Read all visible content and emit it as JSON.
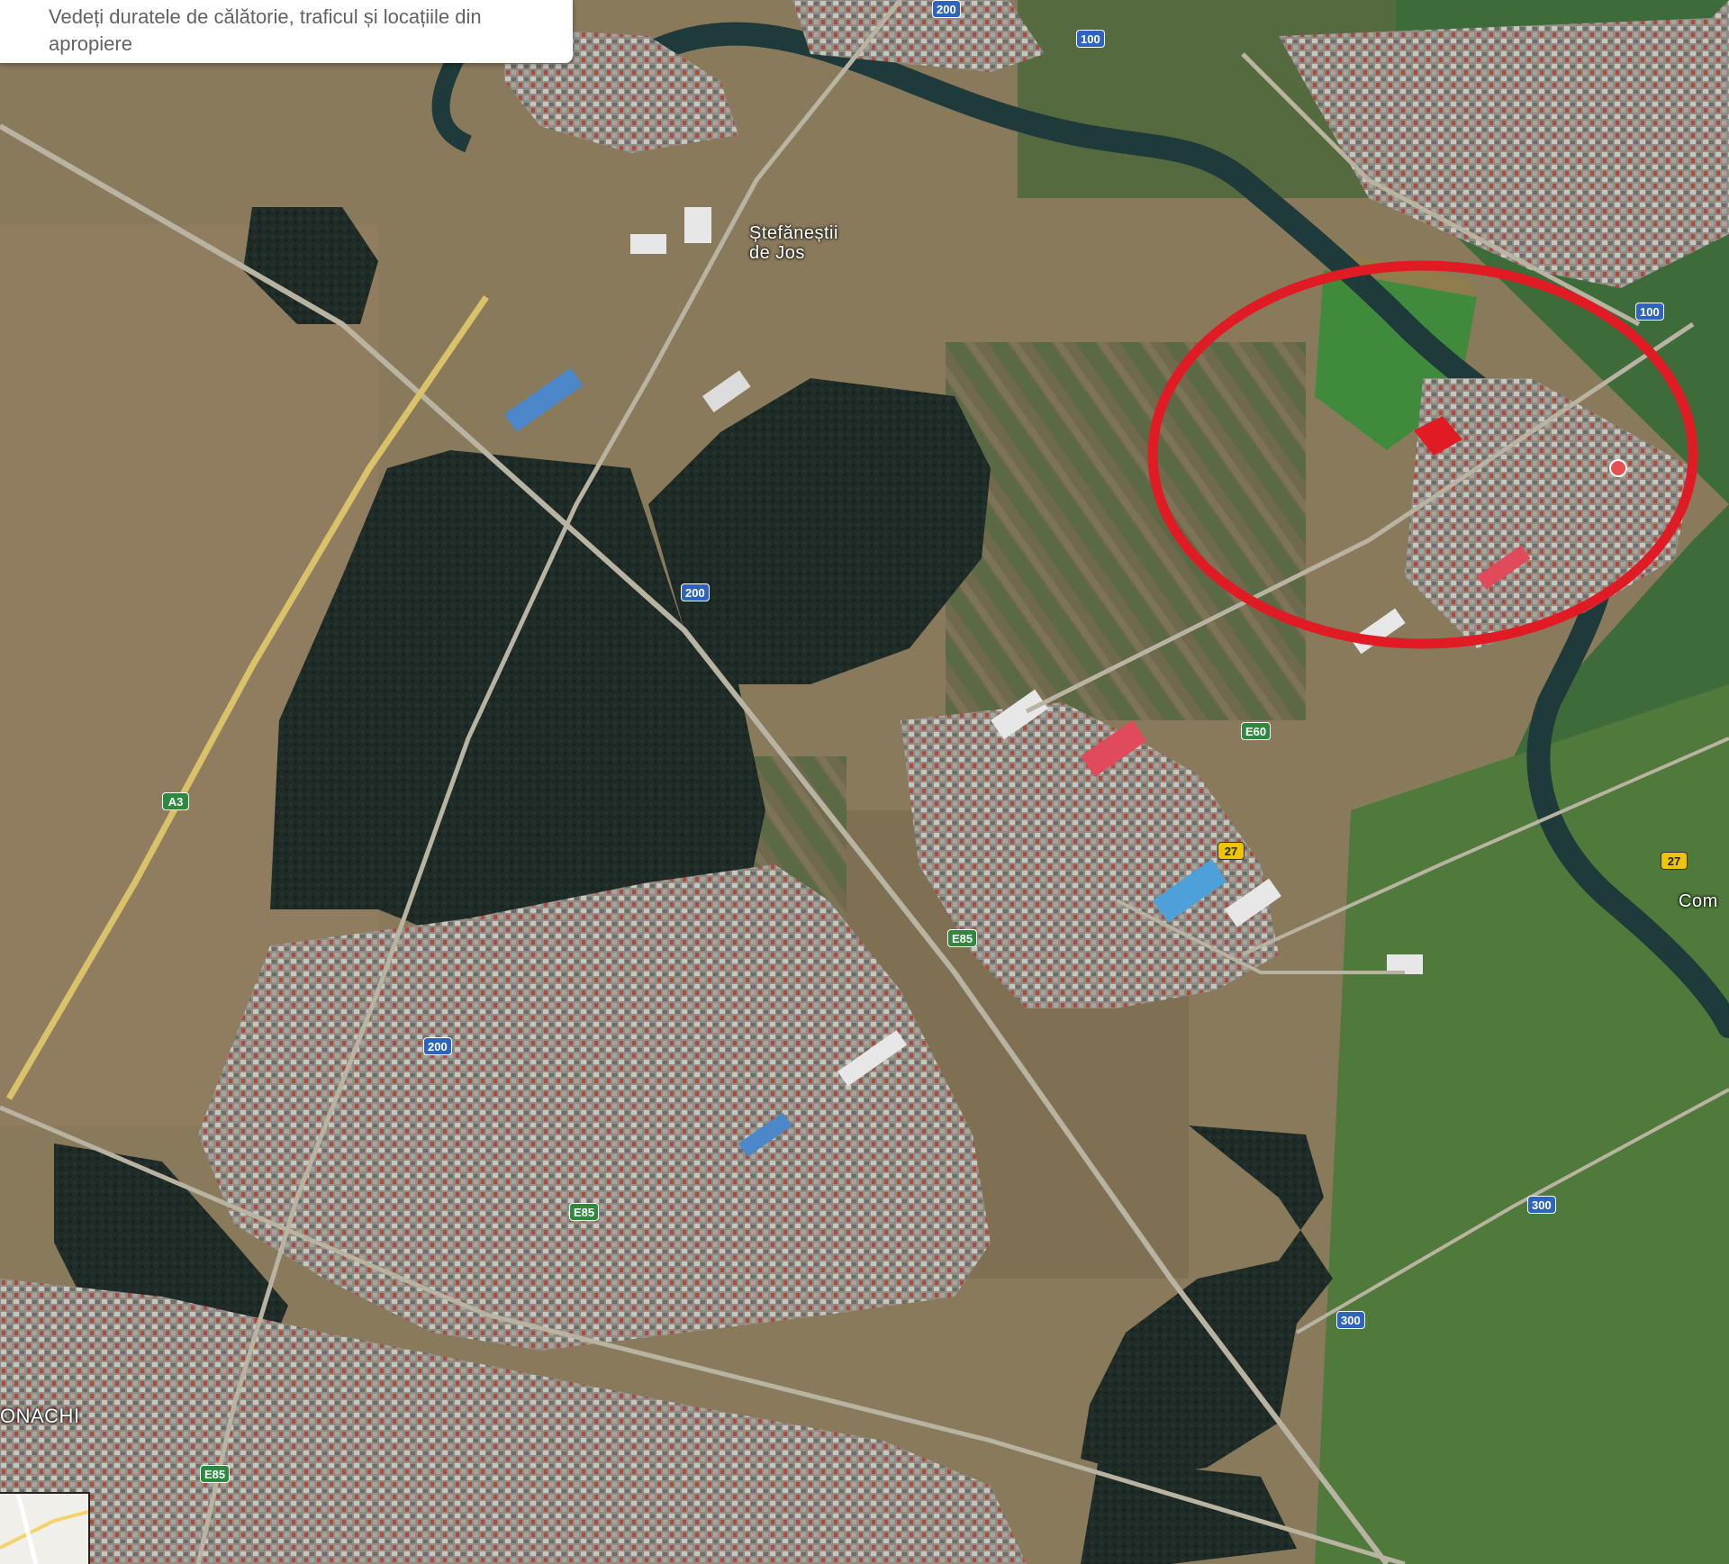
{
  "tooltip": {
    "text": "Vedeți duratele de călătorie, traficul și locațiile din apropiere"
  },
  "map_type": "satellite",
  "highlight": {
    "shape": "circle",
    "color": "#e01b24"
  },
  "road_shields": [
    {
      "id": "s1",
      "text": "200",
      "style": "blue"
    },
    {
      "id": "s2",
      "text": "100",
      "style": "blue"
    },
    {
      "id": "s3",
      "text": "100",
      "style": "blue"
    },
    {
      "id": "s4",
      "text": "200",
      "style": "blue"
    },
    {
      "id": "s5",
      "text": "A3",
      "style": "green"
    },
    {
      "id": "s6",
      "text": "E60",
      "style": "green"
    },
    {
      "id": "s7",
      "text": "27",
      "style": "yellow"
    },
    {
      "id": "s8",
      "text": "27",
      "style": "yellow"
    },
    {
      "id": "s9",
      "text": "E85",
      "style": "green"
    },
    {
      "id": "s10",
      "text": "200",
      "style": "blue"
    },
    {
      "id": "s11",
      "text": "E85",
      "style": "green"
    },
    {
      "id": "s12",
      "text": "300",
      "style": "blue"
    },
    {
      "id": "s13",
      "text": "300",
      "style": "blue"
    },
    {
      "id": "s14",
      "text": "E85",
      "style": "green"
    }
  ],
  "place_labels": [
    {
      "id": "l1",
      "text": "Ștefăneștii de Jos"
    },
    {
      "id": "l2",
      "text": "ONACHI"
    },
    {
      "id": "l3",
      "text": "Com"
    }
  ],
  "colors": {
    "fields_dry": "#8b7b5e",
    "forest_dark": "#1e2a26",
    "fields_green": "#3d6b3a",
    "urban": "#8d8d8a",
    "river": "#1f3a3c",
    "highlight_circle": "#e01b24",
    "shield_blue": "#2f63c0",
    "shield_green": "#2c8a3e",
    "shield_yellow": "#f0c400"
  }
}
